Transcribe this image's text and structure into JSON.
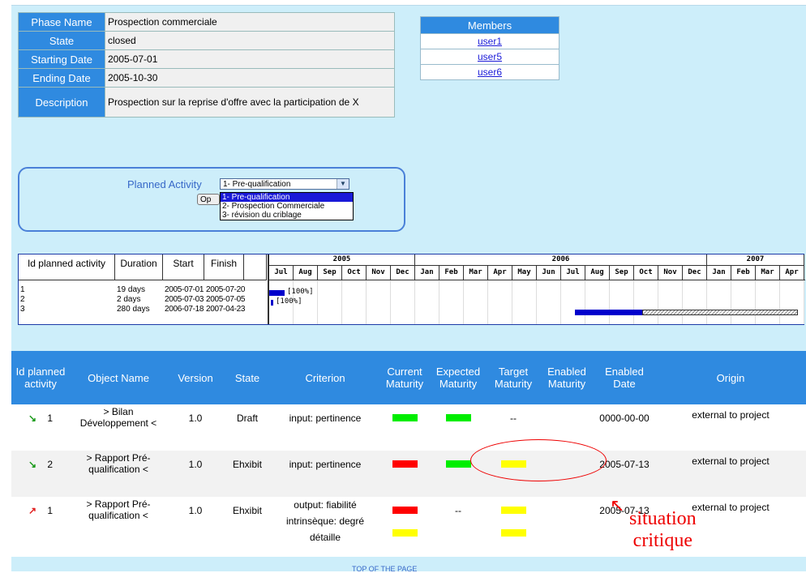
{
  "phase": {
    "rows": [
      {
        "label": "Phase Name",
        "value": "Prospection commerciale"
      },
      {
        "label": "State",
        "value": "closed"
      },
      {
        "label": "Starting Date",
        "value": "2005-07-01"
      },
      {
        "label": "Ending Date",
        "value": "2005-10-30"
      },
      {
        "label": "Description",
        "value": "Prospection sur la reprise d'offre avec la participation de X"
      }
    ]
  },
  "members": {
    "header": "Members",
    "items": [
      "user1",
      "user5",
      "user6"
    ]
  },
  "activity": {
    "label": "Planned Activity",
    "selected": "1- Pre-qualification",
    "open_button": "Op",
    "options": [
      "1- Pre-qualification",
      "2- Prospection Commerciale",
      "3- révision du criblage"
    ]
  },
  "gantt": {
    "headers": [
      "Id planned activity",
      "Duration",
      "Start",
      "Finish"
    ],
    "ids": [
      "1",
      "2",
      "3"
    ],
    "durations": [
      "19 days",
      "2 days",
      "280 days"
    ],
    "starts": [
      "2005-07-01",
      "2005-07-03",
      "2006-07-18"
    ],
    "finishes": [
      "2005-07-20",
      "2005-07-05",
      "2007-04-23"
    ],
    "years": [
      "2005",
      "2006",
      "2007"
    ],
    "months": [
      "Jul",
      "Aug",
      "Sep",
      "Oct",
      "Nov",
      "Dec",
      "Jan",
      "Feb",
      "Mar",
      "Apr",
      "May",
      "Jun",
      "Jul",
      "Aug",
      "Sep",
      "Oct",
      "Nov",
      "Dec",
      "Jan",
      "Feb",
      "Mar",
      "Apr"
    ],
    "bar_labels": [
      "[100%]",
      "[100%]"
    ],
    "progress": [
      1.0,
      1.0,
      0.3
    ],
    "colors": {
      "done": "#0000cc",
      "remaining": "#888888"
    }
  },
  "criteria": {
    "headers": [
      "Id planned activity",
      "Object Name",
      "Version",
      "State",
      "Criterion",
      "Current Maturity",
      "Expected Maturity",
      "Target Maturity",
      "Enabled Maturity",
      "Enabled Date",
      "Origin"
    ],
    "rows": [
      {
        "id": "1",
        "name": "> Bilan Développement <",
        "version": "1.0",
        "state": "Draft",
        "criterion": "input: pertinence",
        "target": "--",
        "date": "0000-00-00",
        "origin": "external to project"
      },
      {
        "id": "2",
        "name": "> Rapport Pré-qualification <",
        "version": "1.0",
        "state": "Ehxibit",
        "criterion": "input: pertinence",
        "date": "2005-07-13",
        "origin": "external to project"
      },
      {
        "id": "1",
        "name": "> Rapport Pré-qualification <",
        "version": "1.0",
        "state": "Ehxibit",
        "criterion": "output: fiabilité intrinsèque: degré détaille",
        "expected": "--",
        "date": "2005-07-13",
        "origin": "external to project"
      }
    ],
    "colors": {
      "green": "#00ee00",
      "red": "#ff0000",
      "yellow": "#ffff00"
    }
  },
  "annotation": {
    "arrow": "↖",
    "line1": "situation",
    "line2": "critique"
  },
  "footer": {
    "top_link": "TOP OF THE PAGE"
  }
}
